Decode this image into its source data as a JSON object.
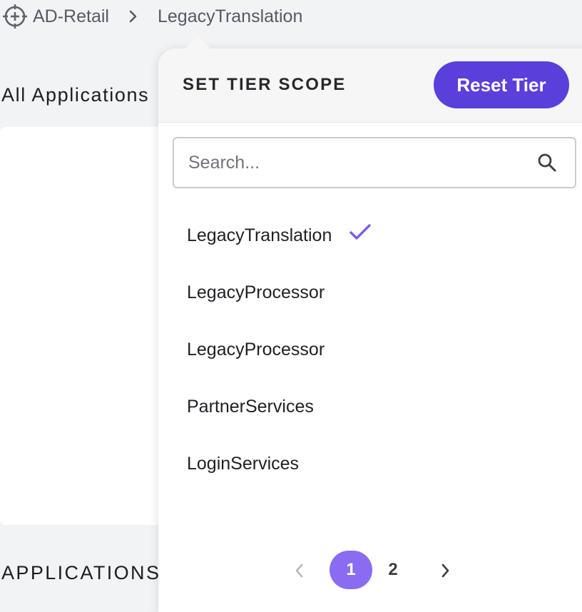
{
  "breadcrumb": {
    "app_icon": "crosshair-icon",
    "app_label": "AD-Retail",
    "separator_icon": "chevron-right-icon",
    "tier_label": "LegacyTranslation"
  },
  "background": {
    "heading": "All Applications",
    "section_heading": "APPLICATIONS"
  },
  "popover": {
    "title": "SET TIER SCOPE",
    "reset_label": "Reset Tier",
    "search_placeholder": "Search...",
    "search_icon": "search-icon",
    "items": [
      {
        "label": "LegacyTranslation",
        "selected": true
      },
      {
        "label": "LegacyProcessor",
        "selected": false
      },
      {
        "label": "LegacyProcessor",
        "selected": false
      },
      {
        "label": "PartnerServices",
        "selected": false
      },
      {
        "label": "LoginServices",
        "selected": false
      }
    ],
    "pagination": {
      "prev_icon": "chevron-left-icon",
      "pages": [
        "1",
        "2"
      ],
      "current_page": "1",
      "next_icon": "chevron-right-icon"
    }
  },
  "colors": {
    "accent": "#5a3fdb",
    "active_page": "#8a6cf2",
    "check": "#7c5ce6",
    "page_background": "#f2f3f5"
  }
}
